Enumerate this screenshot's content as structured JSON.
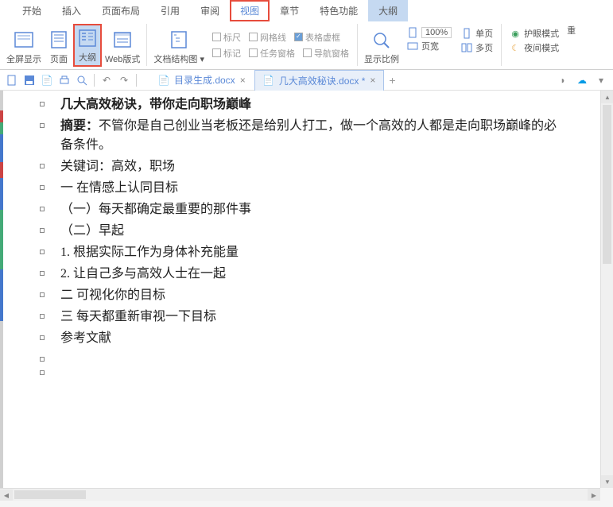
{
  "menu": {
    "items": [
      "开始",
      "插入",
      "页面布局",
      "引用",
      "审阅",
      "视图",
      "章节",
      "特色功能",
      "大纲"
    ],
    "highlighted_index": 5,
    "selected_index": 8
  },
  "ribbon": {
    "view_buttons": [
      {
        "label": "全屏显示",
        "name": "fullscreen"
      },
      {
        "label": "页面",
        "name": "page-view"
      },
      {
        "label": "大纲",
        "name": "outline-view",
        "highlighted": true
      },
      {
        "label": "Web版式",
        "name": "web-layout"
      }
    ],
    "doc_structure": {
      "label": "文档结构图"
    },
    "checks": {
      "row1": [
        {
          "label": "标尺",
          "checked": false
        },
        {
          "label": "网格线",
          "checked": false
        },
        {
          "label": "表格虚框",
          "checked": true
        }
      ],
      "row2": [
        {
          "label": "标记",
          "checked": false
        },
        {
          "label": "任务窗格",
          "checked": false
        },
        {
          "label": "导航窗格",
          "checked": false
        }
      ]
    },
    "zoom_label": "显示比例",
    "zoom_pct": "100%",
    "page_width": "页宽",
    "single_page": "单页",
    "multi_page": "多页",
    "eye_mode": "护眼模式",
    "night_mode": "夜间模式",
    "more": "重"
  },
  "tabs": [
    {
      "label": "目录生成.docx",
      "active": false
    },
    {
      "label": "几大高效秘诀.docx *",
      "active": true
    }
  ],
  "document": {
    "items": [
      {
        "text": "几大高效秘诀，带你走向职场巅峰",
        "bold": true
      },
      {
        "prefix": "摘要：",
        "text": "不管你是自己创业当老板还是给别人打工，做一个高效的人都是走向职场巅峰的必备条件。",
        "prefix_bold": true,
        "wrap": true
      },
      {
        "text": "关键词：高效，职场"
      },
      {
        "text": "一  在情感上认同目标"
      },
      {
        "text": "（一）每天都确定最重要的那件事"
      },
      {
        "text": "（二）早起"
      },
      {
        "text": "1. 根据实际工作为身体补充能量"
      },
      {
        "text": "2. 让自己多与高效人士在一起"
      },
      {
        "text": "二  可视化你的目标"
      },
      {
        "text": "三  每天都重新审视一下目标"
      },
      {
        "text": "参考文献"
      },
      {
        "text": ""
      },
      {
        "text": ""
      }
    ]
  }
}
